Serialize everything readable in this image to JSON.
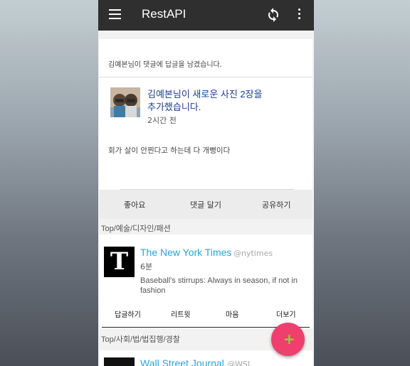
{
  "appbar": {
    "title": "RestAPI",
    "icons": [
      "menu-icon",
      "refresh-icon",
      "more-vert-icon"
    ]
  },
  "notification": {
    "header": "김예본님이 댓글에 답글을 남겼습니다.",
    "post_title": "김예본님이 새로운 사진 2장을 추가했습니다.",
    "post_title_line1": "김예본님이 새로운 사진 2장을",
    "post_title_line2": "추가했습니다.",
    "time": "2시간 전",
    "body": "회가 살이 안찐다고 하는데 다 개뻥이다"
  },
  "actions": {
    "like": "좋아요",
    "comment": "댓글 달기",
    "share": "공유하기"
  },
  "sections": [
    {
      "category": "Top/예술/디자인/패션",
      "tweet": {
        "name": "The New York Times",
        "handle": "@nytimes",
        "time": "6분",
        "body": "Baseball's stirrups: Always in season, if not in fashion",
        "logo": "T"
      },
      "tweet_actions": {
        "reply": "답글하기",
        "retweet": "리트윗",
        "like": "마음",
        "more": "더보기"
      }
    },
    {
      "category": "Top/사회/법/법집행/경찰",
      "tweet": {
        "name": "Wall Street Journal",
        "handle": "@WSJ"
      }
    }
  ],
  "fab": {
    "label": "+"
  },
  "colors": {
    "appbar": "#2f2f2f",
    "link_blue": "#1a3e8c",
    "twitter_blue": "#2aa3d6",
    "fab": "#ee3f6e",
    "fab_plus": "#7bdc3a"
  }
}
